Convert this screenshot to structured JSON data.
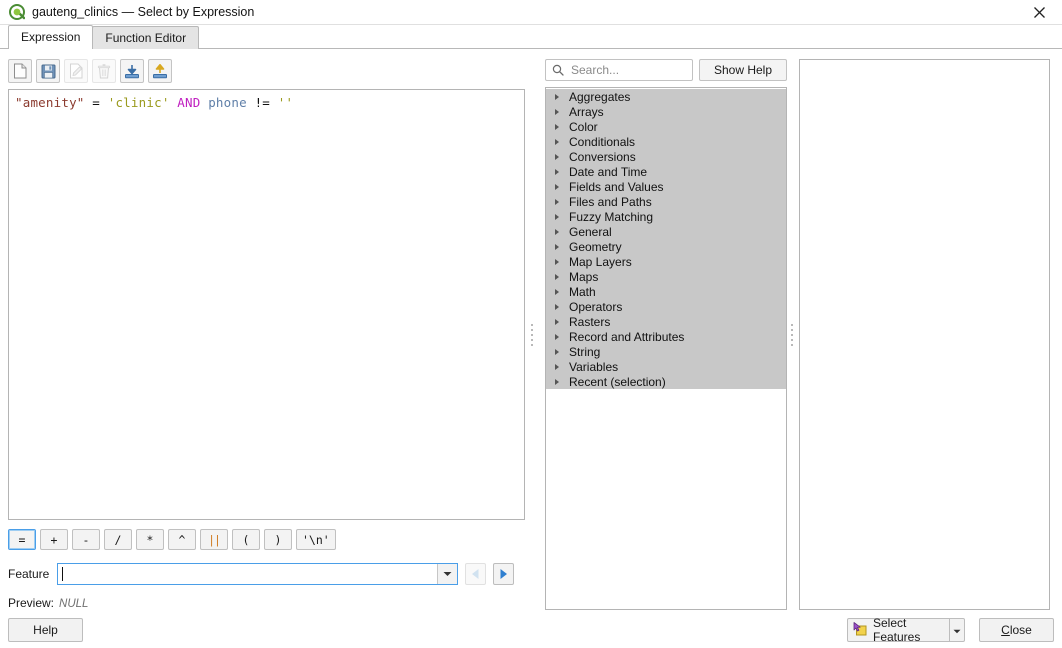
{
  "window": {
    "title": "gauteng_clinics — Select by Expression",
    "app_icon": "qgis-logo-icon",
    "close_icon": "close-icon"
  },
  "tabs": [
    {
      "label": "Expression",
      "active": true
    },
    {
      "label": "Function Editor",
      "active": false
    }
  ],
  "expression_toolbar": [
    {
      "name": "new-expression-button",
      "icon": "new-file-icon",
      "enabled": true
    },
    {
      "name": "save-expression-button",
      "icon": "save-floppy-icon",
      "enabled": true
    },
    {
      "name": "edit-expression-button",
      "icon": "edit-pencil-icon",
      "enabled": false
    },
    {
      "name": "delete-expression-button",
      "icon": "trash-icon",
      "enabled": false
    },
    {
      "name": "import-expressions-button",
      "icon": "import-down-arrow-icon",
      "enabled": true
    },
    {
      "name": "export-expressions-button",
      "icon": "export-up-arrow-icon",
      "enabled": true
    }
  ],
  "expression": {
    "text": "\"amenity\" = 'clinic' AND phone != ''",
    "tokens": [
      {
        "text": "\"amenity\"",
        "type": "field"
      },
      {
        "text": " ",
        "type": "plain"
      },
      {
        "text": "=",
        "type": "operator"
      },
      {
        "text": " ",
        "type": "plain"
      },
      {
        "text": "'clinic'",
        "type": "string"
      },
      {
        "text": " ",
        "type": "plain"
      },
      {
        "text": "AND",
        "type": "keyword"
      },
      {
        "text": " ",
        "type": "plain"
      },
      {
        "text": "phone",
        "type": "column"
      },
      {
        "text": " ",
        "type": "plain"
      },
      {
        "text": "!=",
        "type": "operator"
      },
      {
        "text": " ",
        "type": "plain"
      },
      {
        "text": "''",
        "type": "string"
      }
    ],
    "colors": {
      "field": "#8b3a2e",
      "string": "#9a9a1e",
      "operator": "#101010",
      "keyword": "#c020c0",
      "column": "#5f7fa8"
    }
  },
  "operator_buttons": [
    {
      "label": "=",
      "focused": true
    },
    {
      "label": "+",
      "focused": false
    },
    {
      "label": "-",
      "focused": false
    },
    {
      "label": "/",
      "focused": false
    },
    {
      "label": "*",
      "focused": false
    },
    {
      "label": "^",
      "focused": false
    },
    {
      "label": "||",
      "focused": false,
      "style": "concat"
    },
    {
      "label": "(",
      "focused": false
    },
    {
      "label": ")",
      "focused": false
    },
    {
      "label": "'\\n'",
      "focused": false
    }
  ],
  "feature_row": {
    "label": "Feature",
    "value": "",
    "dropdown_icon": "chevron-down-icon",
    "prev_icon": "arrow-left-icon",
    "next_icon": "arrow-right-icon",
    "prev_enabled": false,
    "next_enabled": true
  },
  "preview": {
    "label": "Preview:",
    "value": "NULL"
  },
  "search": {
    "placeholder": "Search...",
    "value": "",
    "icon": "search-icon"
  },
  "show_help_button": {
    "label": "Show Help"
  },
  "function_tree": {
    "items": [
      {
        "label": "Aggregates"
      },
      {
        "label": "Arrays"
      },
      {
        "label": "Color"
      },
      {
        "label": "Conditionals"
      },
      {
        "label": "Conversions"
      },
      {
        "label": "Date and Time"
      },
      {
        "label": "Fields and Values"
      },
      {
        "label": "Files and Paths"
      },
      {
        "label": "Fuzzy Matching"
      },
      {
        "label": "General"
      },
      {
        "label": "Geometry"
      },
      {
        "label": "Map Layers"
      },
      {
        "label": "Maps"
      },
      {
        "label": "Math"
      },
      {
        "label": "Operators"
      },
      {
        "label": "Rasters"
      },
      {
        "label": "Record and Attributes"
      },
      {
        "label": "String"
      },
      {
        "label": "Variables"
      },
      {
        "label": "Recent (selection)"
      }
    ]
  },
  "help_panel": {
    "content": ""
  },
  "footer": {
    "help_label": "Help",
    "select_features_label": "Select Features",
    "select_features_icon": "select-features-icon",
    "select_features_dropdown_icon": "chevron-down-icon",
    "close_label": "Close"
  },
  "theme": {
    "accent": "#4a9ee8",
    "tree_selection_bg": "#c8c8c8",
    "panel_border": "#b4b4b4"
  }
}
